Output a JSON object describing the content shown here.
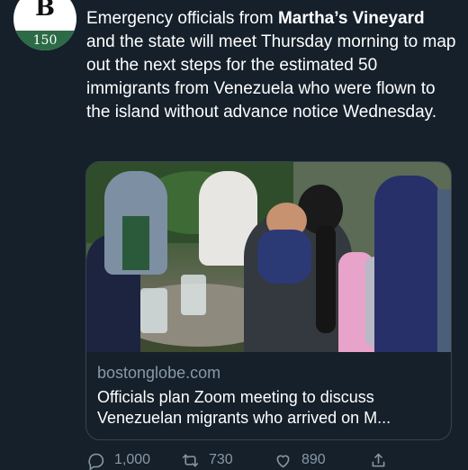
{
  "avatar": {
    "logo_letter": "B",
    "logo_number": "150"
  },
  "tweet": {
    "text_part1": "Emergency officials from ",
    "text_bold": "Martha’s Vineyard",
    "text_part2": " and the state will meet Thursday morning to map out the next steps for the estimated 50 immigrants from Venezuela who were flown to the island without advance notice Wednesday."
  },
  "card": {
    "domain": "bostonglobe.com",
    "title_line1": "Officials plan Zoom meeting to discuss",
    "title_line2": "Venezuelan migrants who arrived on M..."
  },
  "actions": {
    "reply_count": "1,000",
    "retweet_count": "730",
    "like_count": "890"
  },
  "colors": {
    "background": "#15202b",
    "text": "#ffffff",
    "muted": "#8899a6",
    "border": "#38444d",
    "logo_band": "#2c6b46"
  },
  "icons": [
    "reply-icon",
    "retweet-icon",
    "like-icon",
    "share-icon"
  ]
}
